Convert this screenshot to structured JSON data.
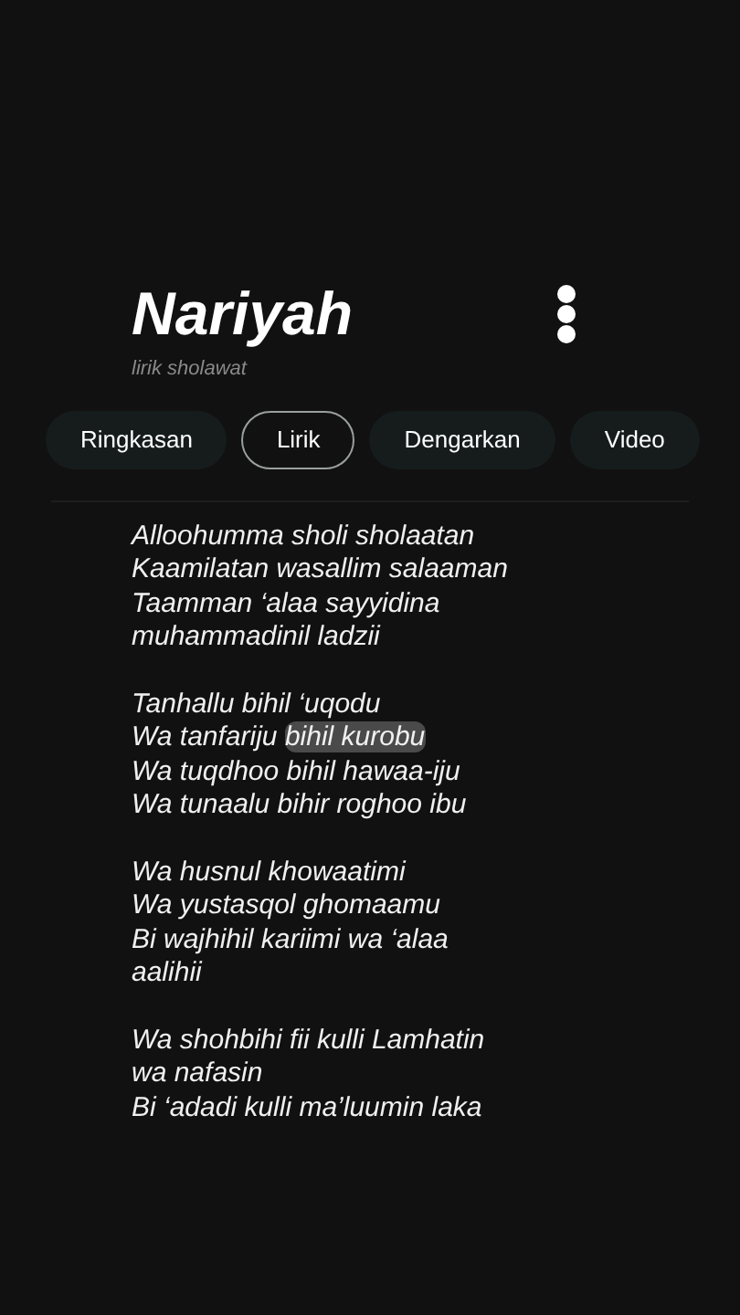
{
  "header": {
    "title": "Nariyah",
    "subtitle": "lirik sholawat"
  },
  "tabs": [
    {
      "label": "Ringkasan",
      "selected": false
    },
    {
      "label": "Lirik",
      "selected": true
    },
    {
      "label": "Dengarkan",
      "selected": false
    },
    {
      "label": "Video",
      "selected": false
    }
  ],
  "lyrics": [
    [
      {
        "parts": [
          {
            "text": "Alloohumma sholi sholaatan",
            "highlighted": false
          }
        ]
      },
      {
        "parts": [
          {
            "text": "Kaamilatan wasallim salaaman",
            "highlighted": false
          }
        ]
      },
      {
        "parts": [
          {
            "text": "Taamman ‘alaa sayyidina",
            "highlighted": false
          }
        ]
      },
      {
        "parts": [
          {
            "text": "muhammadinil ladzii",
            "highlighted": false
          }
        ]
      }
    ],
    [
      {
        "parts": [
          {
            "text": "Tanhallu bihil ‘uqodu",
            "highlighted": false
          }
        ]
      },
      {
        "parts": [
          {
            "text": "Wa tanfariju ",
            "highlighted": false
          },
          {
            "text": "bihil kurobu",
            "highlighted": true
          }
        ]
      },
      {
        "parts": [
          {
            "text": "Wa tuqdhoo bihil hawaa-iju",
            "highlighted": false
          }
        ]
      },
      {
        "parts": [
          {
            "text": "Wa tunaalu bihir roghoo ibu",
            "highlighted": false
          }
        ]
      }
    ],
    [
      {
        "parts": [
          {
            "text": "Wa husnul khowaatimi",
            "highlighted": false
          }
        ]
      },
      {
        "parts": [
          {
            "text": "Wa yustasqol ghomaamu",
            "highlighted": false
          }
        ]
      },
      {
        "parts": [
          {
            "text": "Bi wajhihil kariimi wa ‘alaa",
            "highlighted": false
          }
        ]
      },
      {
        "parts": [
          {
            "text": "aalihii",
            "highlighted": false
          }
        ]
      }
    ],
    [
      {
        "parts": [
          {
            "text": "Wa shohbihi fii kulli Lamhatin",
            "highlighted": false
          }
        ]
      },
      {
        "parts": [
          {
            "text": "wa nafasin",
            "highlighted": false
          }
        ]
      },
      {
        "parts": [
          {
            "text": "Bi ‘adadi kulli ma’luumin laka",
            "highlighted": false
          }
        ]
      }
    ]
  ]
}
